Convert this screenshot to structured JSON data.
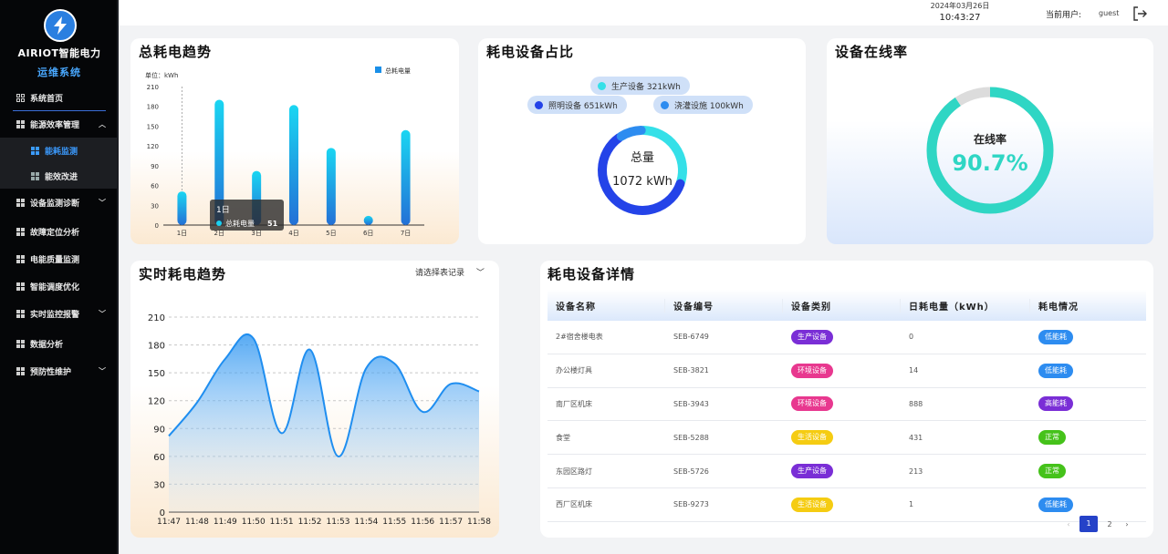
{
  "sidebar": {
    "brand": "AIRIOT智能电力",
    "subtitle": "运维系统",
    "items": [
      {
        "label": "系统首页"
      },
      {
        "label": "能源效率管理"
      },
      {
        "label": "能耗监测"
      },
      {
        "label": "能效改进"
      },
      {
        "label": "设备监测诊断"
      },
      {
        "label": "故障定位分析"
      },
      {
        "label": "电能质量监测"
      },
      {
        "label": "智能调度优化"
      },
      {
        "label": "实时监控报警"
      },
      {
        "label": "数据分析"
      },
      {
        "label": "预防性维护"
      }
    ],
    "accent_color": "#3b9bff"
  },
  "header": {
    "date": "2024年03月26日",
    "time": "10:43:27",
    "user_label": "当前用户:",
    "user_name": "guest"
  },
  "cards": {
    "total": {
      "title": "总耗电趋势",
      "unit_label": "单位：kWh",
      "legend": "总耗电量",
      "tooltip_title": "1日",
      "tooltip_label": "总耗电量",
      "tooltip_value": "51"
    },
    "share": {
      "title": "耗电设备占比",
      "center_label": "总量",
      "center_value": "1072 kWh",
      "pills": [
        {
          "text": "生产设备 321kWh",
          "color": "#35e0e8"
        },
        {
          "text": "照明设备 651kWh",
          "color": "#2443e8"
        },
        {
          "text": "浇灌设施 100kWh",
          "color": "#2d8cf0"
        }
      ]
    },
    "online": {
      "title": "设备在线率",
      "label": "在线率",
      "value": "90.7%",
      "rate": 0.907,
      "color": "#2fd6c4"
    },
    "realtime": {
      "title": "实时耗电趋势",
      "select_placeholder": "请选择表记录"
    },
    "detail": {
      "title": "耗电设备详情",
      "columns": [
        "设备名称",
        "设备编号",
        "设备类别",
        "日耗电量（kWh）",
        "耗电情况"
      ],
      "rows": [
        {
          "name": "2#宿舍楼电表",
          "code": "SEB-6749",
          "category": "生产设备",
          "cat_color": "#7a2ed6",
          "kwh": "0",
          "status": "低能耗",
          "status_color": "#2d8cf0"
        },
        {
          "name": "办公楼灯具",
          "code": "SEB-3821",
          "category": "环境设备",
          "cat_color": "#e8388f",
          "kwh": "14",
          "status": "低能耗",
          "status_color": "#2d8cf0"
        },
        {
          "name": "南厂区机床",
          "code": "SEB-3943",
          "category": "环境设备",
          "cat_color": "#e8388f",
          "kwh": "888",
          "status": "高能耗",
          "status_color": "#7a2ed6"
        },
        {
          "name": "食堂",
          "code": "SEB-5288",
          "category": "生活设备",
          "cat_color": "#f5cc12",
          "kwh": "431",
          "status": "正常",
          "status_color": "#45c21a"
        },
        {
          "name": "东园区路灯",
          "code": "SEB-5726",
          "category": "生产设备",
          "cat_color": "#7a2ed6",
          "kwh": "213",
          "status": "正常",
          "status_color": "#45c21a"
        },
        {
          "name": "西厂区机床",
          "code": "SEB-9273",
          "category": "生活设备",
          "cat_color": "#f5cc12",
          "kwh": "1",
          "status": "低能耗",
          "status_color": "#2d8cf0"
        }
      ],
      "pager": {
        "prev": "‹",
        "pages": [
          "1",
          "2"
        ],
        "active": "1",
        "next": "›"
      }
    }
  },
  "chart_data": [
    {
      "type": "bar",
      "title": "总耗电趋势",
      "ylabel": "单位：kWh",
      "categories": [
        "1日",
        "2日",
        "3日",
        "4日",
        "5日",
        "6日",
        "7日"
      ],
      "series": [
        {
          "name": "总耗电量",
          "values": [
            51,
            190,
            82,
            182,
            117,
            14,
            144
          ]
        }
      ],
      "yticks": [
        "0",
        "30",
        "60",
        "90",
        "120",
        "150",
        "180",
        "210"
      ],
      "ylim": [
        0,
        210
      ]
    },
    {
      "type": "pie",
      "title": "耗电设备占比",
      "labels": [
        "生产设备",
        "照明设备",
        "浇灌设施"
      ],
      "values": [
        321,
        651,
        100
      ]
    },
    {
      "type": "area",
      "title": "实时耗电趋势",
      "categories": [
        "11:47",
        "11:48",
        "11:49",
        "11:50",
        "11:51",
        "11:52",
        "11:53",
        "11:54",
        "11:55",
        "11:56",
        "11:57",
        "11:58"
      ],
      "values": [
        82,
        118,
        165,
        187,
        85,
        175,
        60,
        155,
        160,
        108,
        138,
        130
      ],
      "yticks": [
        "0",
        "30",
        "60",
        "90",
        "120",
        "150",
        "180",
        "210"
      ],
      "ylim": [
        0,
        210
      ]
    }
  ]
}
